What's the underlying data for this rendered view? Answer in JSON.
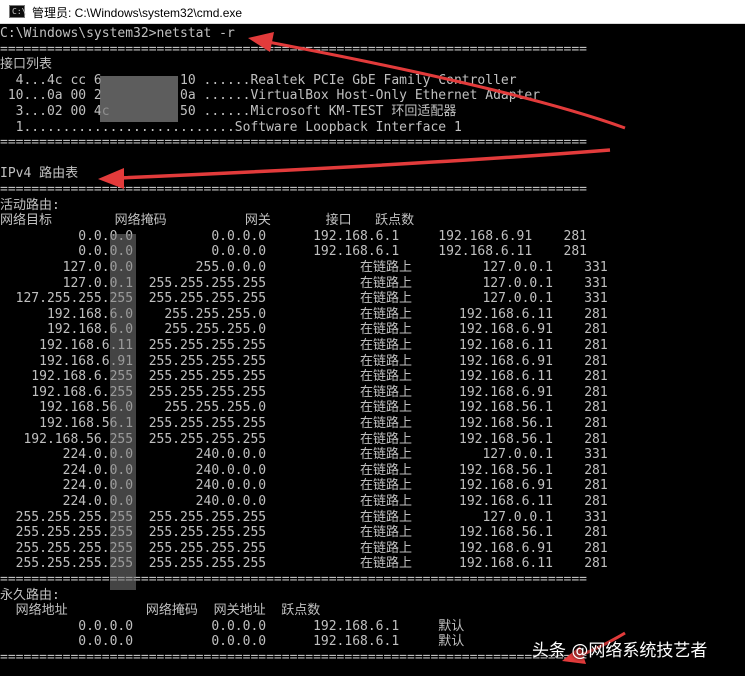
{
  "window": {
    "title": "管理员: C:\\Windows\\system32\\cmd.exe",
    "icon": "cmd-icon",
    "icon_glyph": "C:\\"
  },
  "console": {
    "lines": [
      "C:\\Windows\\system32>netstat -r",
      "===========================================================================",
      "接口列表",
      "  4...4c cc 6          10 ......Realtek PCIe GbE Family Controller",
      " 10...0a 00 2          0a ......VirtualBox Host-Only Ethernet Adapter",
      "  3...02 00 4c         50 ......Microsoft KM-TEST 环回适配器",
      "  1...........................Software Loopback Interface 1",
      "===========================================================================",
      "",
      "IPv4 路由表",
      "===========================================================================",
      "活动路由:",
      "网络目标        网络掩码          网关       接口   跃点数",
      "          0.0.0.0          0.0.0.0      192.168.6.1     192.168.6.91    281",
      "          0.0.0.0          0.0.0.0      192.168.6.1     192.168.6.11    281",
      "        127.0.0.0        255.0.0.0            在链路上         127.0.0.1    331",
      "        127.0.0.1  255.255.255.255            在链路上         127.0.0.1    331",
      "  127.255.255.255  255.255.255.255            在链路上         127.0.0.1    331",
      "      192.168.6.0    255.255.255.0            在链路上      192.168.6.11    281",
      "      192.168.6.0    255.255.255.0            在链路上      192.168.6.91    281",
      "     192.168.6.11  255.255.255.255            在链路上      192.168.6.11    281",
      "     192.168.6.91  255.255.255.255            在链路上      192.168.6.91    281",
      "    192.168.6.255  255.255.255.255            在链路上      192.168.6.11    281",
      "    192.168.6.255  255.255.255.255            在链路上      192.168.6.91    281",
      "     192.168.56.0    255.255.255.0            在链路上      192.168.56.1    281",
      "     192.168.56.1  255.255.255.255            在链路上      192.168.56.1    281",
      "   192.168.56.255  255.255.255.255            在链路上      192.168.56.1    281",
      "        224.0.0.0        240.0.0.0            在链路上         127.0.0.1    331",
      "        224.0.0.0        240.0.0.0            在链路上      192.168.56.1    281",
      "        224.0.0.0        240.0.0.0            在链路上      192.168.6.91    281",
      "        224.0.0.0        240.0.0.0            在链路上      192.168.6.11    281",
      "  255.255.255.255  255.255.255.255            在链路上         127.0.0.1    331",
      "  255.255.255.255  255.255.255.255            在链路上      192.168.56.1    281",
      "  255.255.255.255  255.255.255.255            在链路上      192.168.6.91    281",
      "  255.255.255.255  255.255.255.255            在链路上      192.168.6.11    281",
      "===========================================================================",
      "永久路由:",
      "  网络地址          网络掩码  网关地址  跃点数",
      "          0.0.0.0          0.0.0.0      192.168.6.1     默认",
      "          0.0.0.0          0.0.0.0      192.168.6.1     默认",
      "==========================================================================="
    ]
  },
  "watermark": "头条 @网络系统技艺者",
  "colors": {
    "console_bg": "#000000",
    "console_text": "#c0c0c0",
    "arrow": "#e23b3b",
    "titlebar_bg": "#ffffff"
  }
}
